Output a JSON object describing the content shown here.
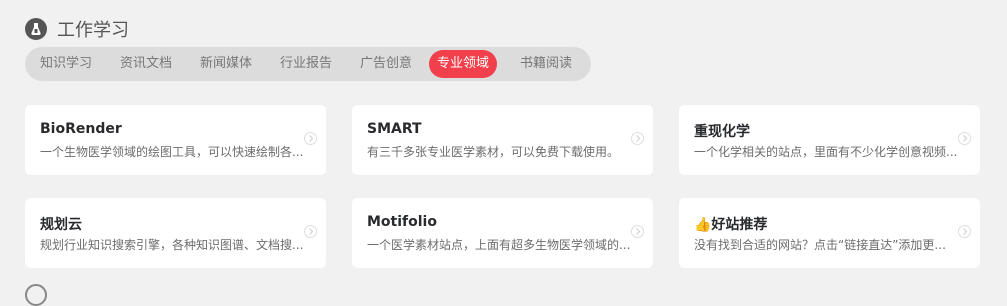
{
  "section": {
    "title": "工作学习",
    "icon": "flask-icon"
  },
  "tabs": [
    {
      "label": "知识学习",
      "active": false
    },
    {
      "label": "资讯文档",
      "active": false
    },
    {
      "label": "新闻媒体",
      "active": false
    },
    {
      "label": "行业报告",
      "active": false
    },
    {
      "label": "广告创意",
      "active": false
    },
    {
      "label": "专业领域",
      "active": true
    },
    {
      "label": "书籍阅读",
      "active": false
    }
  ],
  "colors": {
    "accent": "#f1404b",
    "background": "#f1f1f1",
    "tab_bar": "#dcdcdc"
  },
  "cards": [
    {
      "title": "BioRender",
      "desc": "一个生物医学领域的绘图工具，可以快速绘制各..."
    },
    {
      "title": "SMART",
      "desc": "有三千多张专业医学素材，可以免费下载使用。"
    },
    {
      "title": "重现化学",
      "desc": "一个化学相关的站点，里面有不少化学创意视频..."
    },
    {
      "title": "规划云",
      "desc": "规划行业知识搜索引擎，各种知识图谱、文档搜..."
    },
    {
      "title": "Motifolio",
      "desc": "一个医学素材站点，上面有超多生物医学领域的..."
    },
    {
      "title": "👍好站推荐",
      "desc": "没有找到合适的网站？点击“链接直达”添加更..."
    }
  ]
}
